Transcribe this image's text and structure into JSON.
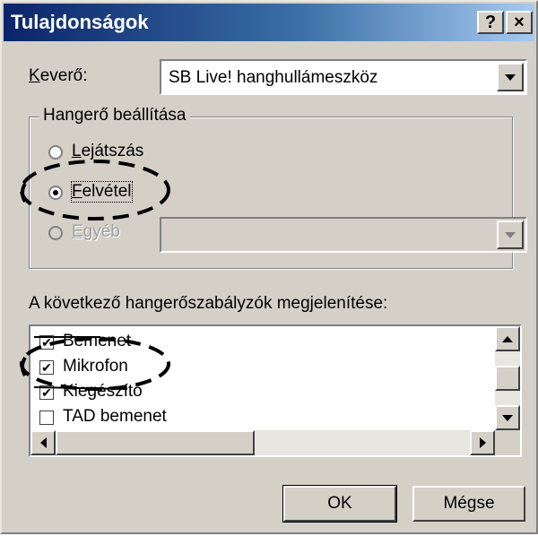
{
  "window": {
    "title": "Tulajdonságok",
    "help_button": "?",
    "close_button": "×"
  },
  "mixer": {
    "label": "Keverő:",
    "value": "SB Live! hanghullámeszköz"
  },
  "volume_group": {
    "legend": "Hangerő beállítása",
    "options": [
      {
        "label": "Lejátszás",
        "checked": false,
        "enabled": true
      },
      {
        "label": "Felvétel",
        "checked": true,
        "enabled": true
      },
      {
        "label": "Egyéb",
        "checked": false,
        "enabled": false
      }
    ],
    "other_combo_value": ""
  },
  "controls_list": {
    "label": "A következő hangerőszabályzók megjelenítése:",
    "items": [
      {
        "label": "Bemenet",
        "checked": true
      },
      {
        "label": "Mikrofon",
        "checked": true
      },
      {
        "label": "Kiegészítő",
        "checked": true
      },
      {
        "label": "TAD bemenet",
        "checked": false
      }
    ]
  },
  "buttons": {
    "ok": "OK",
    "cancel": "Mégse"
  },
  "check_glyph": "✔",
  "colors": {
    "face": "#d4d0c8",
    "title_start": "#0a246a",
    "title_end": "#a6caf0"
  }
}
